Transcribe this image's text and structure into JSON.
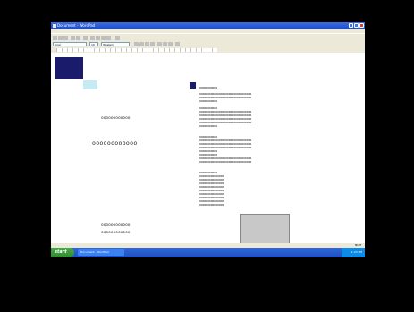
{
  "window": {
    "title": "Document - WordPad"
  },
  "menu": [
    "File",
    "Edit",
    "View",
    "Insert",
    "Format",
    "Help"
  ],
  "format_bar": {
    "font": "Arial",
    "size": "10",
    "script": "Western"
  },
  "document": {
    "left_lines": [
      "oooooooooooo",
      "oooooooooooo",
      "oooooooooooo",
      "oooooooooooo"
    ],
    "heading": "oooooooooooo",
    "right_col": [
      "ooooooooooo",
      "oooooooooooooooooooooooooooooooo",
      "oooooooooooooooooooooooooooooooo",
      "ooooooooooo",
      "ooooooooooo",
      "oooooooooooooooooooooooooooooooo",
      "oooooooooooooooooooooooooooooooo",
      "oooooooooooooooooooooooooooooooo",
      "oooooooooooooooooooooooooooooooo",
      "ooooooooooo",
      "ooooooooooo",
      "oooooooooooooooooooooooooooooooo",
      "oooooooooooooooooooooooooooooooo",
      "oooooooooooooooooooooooooooooooo",
      "ooooooooooo",
      "ooooooooooo",
      "oooooooooooooooooooooooooooooooo",
      "oooooooooooooooooooooooooooooooo",
      "ooooooooooo",
      "ooooooooooooooo",
      "ooooooooooooooo",
      "ooooooooooooooo",
      "ooooooooooooooo",
      "ooooooooooooooo",
      "ooooooooooooooo",
      "ooooooooooooooo",
      "ooooooooooooooo",
      "ooooooooooooooo"
    ]
  },
  "status": {
    "text": "For Help, press F1",
    "right": "NUM"
  },
  "taskbar": {
    "start": "start",
    "item": "Document - WordPad",
    "clock": "1:23 PM"
  },
  "colors": {
    "navy_block": "#1b1b6b",
    "light_cyan": "#c6eaf2",
    "gray_box": "#c8c8c8"
  }
}
